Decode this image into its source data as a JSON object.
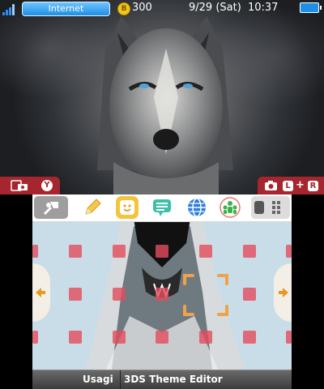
{
  "status": {
    "network": "Internet",
    "coin_symbol": "B",
    "coins": "300",
    "date": "9/29 (Sat)",
    "time": "10:37"
  },
  "top_hint": {
    "y_button": "Y",
    "l_button": "L",
    "plus": "+",
    "r_button": "R"
  },
  "toolbar": {
    "icons": [
      "settings-icon",
      "pencil-icon",
      "smiley-icon",
      "chat-icon",
      "globe-icon",
      "friends-icon"
    ]
  },
  "footer": {
    "user": "Usagi",
    "app": "3DS Theme Editor"
  },
  "colors": {
    "accent_red": "#a5262e",
    "status_blue": "#1f8ee6",
    "tile_red": "#e44d5d",
    "cursor_orange": "#f0a24a"
  }
}
